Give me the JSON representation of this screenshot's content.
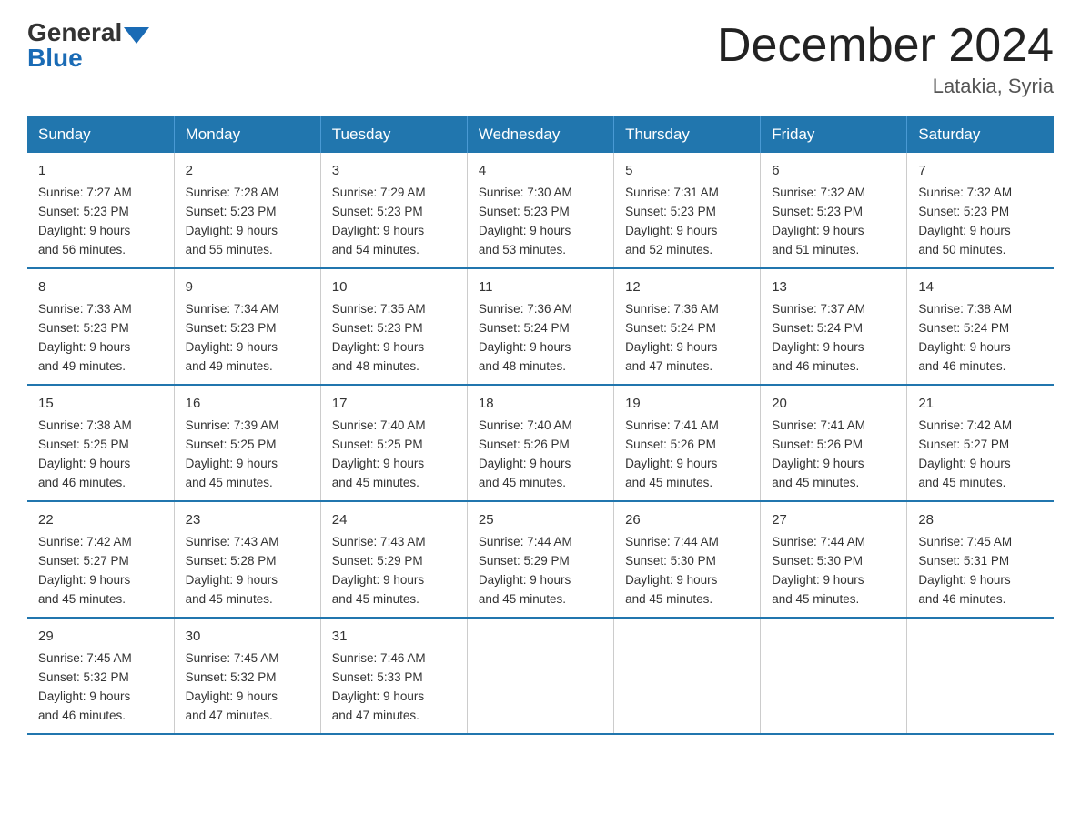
{
  "header": {
    "logo_general": "General",
    "logo_blue": "Blue",
    "title": "December 2024",
    "location": "Latakia, Syria"
  },
  "days_of_week": [
    "Sunday",
    "Monday",
    "Tuesday",
    "Wednesday",
    "Thursday",
    "Friday",
    "Saturday"
  ],
  "weeks": [
    [
      {
        "day": "1",
        "sunrise": "7:27 AM",
        "sunset": "5:23 PM",
        "daylight": "9 hours and 56 minutes."
      },
      {
        "day": "2",
        "sunrise": "7:28 AM",
        "sunset": "5:23 PM",
        "daylight": "9 hours and 55 minutes."
      },
      {
        "day": "3",
        "sunrise": "7:29 AM",
        "sunset": "5:23 PM",
        "daylight": "9 hours and 54 minutes."
      },
      {
        "day": "4",
        "sunrise": "7:30 AM",
        "sunset": "5:23 PM",
        "daylight": "9 hours and 53 minutes."
      },
      {
        "day": "5",
        "sunrise": "7:31 AM",
        "sunset": "5:23 PM",
        "daylight": "9 hours and 52 minutes."
      },
      {
        "day": "6",
        "sunrise": "7:32 AM",
        "sunset": "5:23 PM",
        "daylight": "9 hours and 51 minutes."
      },
      {
        "day": "7",
        "sunrise": "7:32 AM",
        "sunset": "5:23 PM",
        "daylight": "9 hours and 50 minutes."
      }
    ],
    [
      {
        "day": "8",
        "sunrise": "7:33 AM",
        "sunset": "5:23 PM",
        "daylight": "9 hours and 49 minutes."
      },
      {
        "day": "9",
        "sunrise": "7:34 AM",
        "sunset": "5:23 PM",
        "daylight": "9 hours and 49 minutes."
      },
      {
        "day": "10",
        "sunrise": "7:35 AM",
        "sunset": "5:23 PM",
        "daylight": "9 hours and 48 minutes."
      },
      {
        "day": "11",
        "sunrise": "7:36 AM",
        "sunset": "5:24 PM",
        "daylight": "9 hours and 48 minutes."
      },
      {
        "day": "12",
        "sunrise": "7:36 AM",
        "sunset": "5:24 PM",
        "daylight": "9 hours and 47 minutes."
      },
      {
        "day": "13",
        "sunrise": "7:37 AM",
        "sunset": "5:24 PM",
        "daylight": "9 hours and 46 minutes."
      },
      {
        "day": "14",
        "sunrise": "7:38 AM",
        "sunset": "5:24 PM",
        "daylight": "9 hours and 46 minutes."
      }
    ],
    [
      {
        "day": "15",
        "sunrise": "7:38 AM",
        "sunset": "5:25 PM",
        "daylight": "9 hours and 46 minutes."
      },
      {
        "day": "16",
        "sunrise": "7:39 AM",
        "sunset": "5:25 PM",
        "daylight": "9 hours and 45 minutes."
      },
      {
        "day": "17",
        "sunrise": "7:40 AM",
        "sunset": "5:25 PM",
        "daylight": "9 hours and 45 minutes."
      },
      {
        "day": "18",
        "sunrise": "7:40 AM",
        "sunset": "5:26 PM",
        "daylight": "9 hours and 45 minutes."
      },
      {
        "day": "19",
        "sunrise": "7:41 AM",
        "sunset": "5:26 PM",
        "daylight": "9 hours and 45 minutes."
      },
      {
        "day": "20",
        "sunrise": "7:41 AM",
        "sunset": "5:26 PM",
        "daylight": "9 hours and 45 minutes."
      },
      {
        "day": "21",
        "sunrise": "7:42 AM",
        "sunset": "5:27 PM",
        "daylight": "9 hours and 45 minutes."
      }
    ],
    [
      {
        "day": "22",
        "sunrise": "7:42 AM",
        "sunset": "5:27 PM",
        "daylight": "9 hours and 45 minutes."
      },
      {
        "day": "23",
        "sunrise": "7:43 AM",
        "sunset": "5:28 PM",
        "daylight": "9 hours and 45 minutes."
      },
      {
        "day": "24",
        "sunrise": "7:43 AM",
        "sunset": "5:29 PM",
        "daylight": "9 hours and 45 minutes."
      },
      {
        "day": "25",
        "sunrise": "7:44 AM",
        "sunset": "5:29 PM",
        "daylight": "9 hours and 45 minutes."
      },
      {
        "day": "26",
        "sunrise": "7:44 AM",
        "sunset": "5:30 PM",
        "daylight": "9 hours and 45 minutes."
      },
      {
        "day": "27",
        "sunrise": "7:44 AM",
        "sunset": "5:30 PM",
        "daylight": "9 hours and 45 minutes."
      },
      {
        "day": "28",
        "sunrise": "7:45 AM",
        "sunset": "5:31 PM",
        "daylight": "9 hours and 46 minutes."
      }
    ],
    [
      {
        "day": "29",
        "sunrise": "7:45 AM",
        "sunset": "5:32 PM",
        "daylight": "9 hours and 46 minutes."
      },
      {
        "day": "30",
        "sunrise": "7:45 AM",
        "sunset": "5:32 PM",
        "daylight": "9 hours and 47 minutes."
      },
      {
        "day": "31",
        "sunrise": "7:46 AM",
        "sunset": "5:33 PM",
        "daylight": "9 hours and 47 minutes."
      },
      null,
      null,
      null,
      null
    ]
  ],
  "sunrise_label": "Sunrise:",
  "sunset_label": "Sunset:",
  "daylight_label": "Daylight:"
}
